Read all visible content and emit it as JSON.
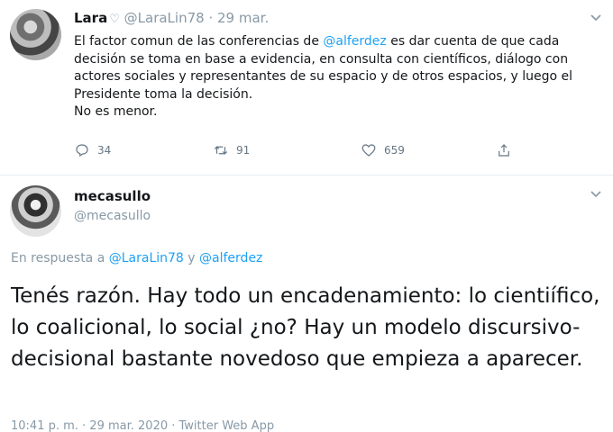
{
  "tweet1": {
    "name": "Lara",
    "heart_icon": "heart-icon",
    "handle": "@LaraLin78",
    "separator": "·",
    "date": "29 mar.",
    "text_before_mention": "El factor comun de las conferencias de ",
    "mention": "@alferdez",
    "text_after_mention": " es dar cuenta de que cada decisión se toma en base a evidencia, en consulta con científicos, diálogo con actores sociales y representantes de su espacio y de otros espacios, y luego el Presidente toma la decisión.",
    "text_line2": "No es menor.",
    "replies": "34",
    "retweets": "91",
    "likes": "659"
  },
  "tweet2": {
    "name": "mecasullo",
    "handle": "@mecasullo",
    "reply_prefix": "En respuesta a ",
    "reply_mention1": "@LaraLin78",
    "reply_and": " y ",
    "reply_mention2": "@alferdez",
    "text": "Tenés razón. Hay todo un encadenamiento: lo cientiífico, lo coalicional, lo social ¿no? Hay un modelo discursivo-decisional bastante novedoso que empieza a aparecer.",
    "meta": "10:41 p. m. · 29 mar. 2020 · Twitter Web App"
  },
  "colors": {
    "accent": "#1da1f2",
    "muted": "#8899a6",
    "text": "#14171a"
  }
}
